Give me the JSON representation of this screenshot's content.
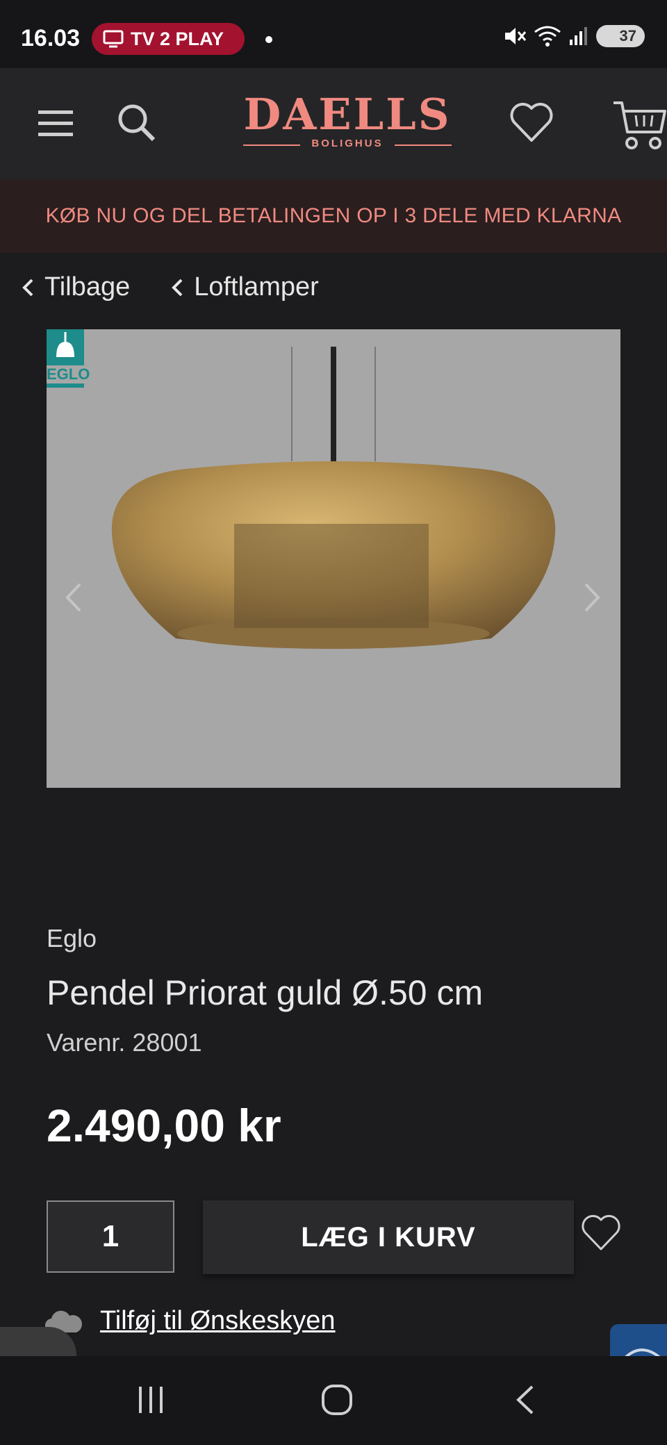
{
  "status_bar": {
    "time": "16.03",
    "app_pill": "TV 2 PLAY",
    "battery": "37"
  },
  "header": {
    "logo_main": "DAELLS",
    "logo_sub": "BOLIGHUS"
  },
  "promo": {
    "text": "KØB NU OG DEL BETALINGEN OP I 3 DELE MED KLARNA"
  },
  "breadcrumbs": [
    {
      "label": "Tilbage"
    },
    {
      "label": "Loftlamper"
    }
  ],
  "product": {
    "image_badge": "EGLO",
    "brand": "Eglo",
    "title": "Pendel Priorat guld Ø.50 cm",
    "sku": "Varenr. 28001",
    "price": "2.490,00 kr",
    "quantity": "1",
    "add_to_cart": "LÆG I KURV",
    "wishlist_link": "Tilføj til Ønskeskyen"
  },
  "colors": {
    "brand_accent": "#f08a80",
    "tv2_pill": "#a3122f",
    "background": "#1c1c1e"
  }
}
